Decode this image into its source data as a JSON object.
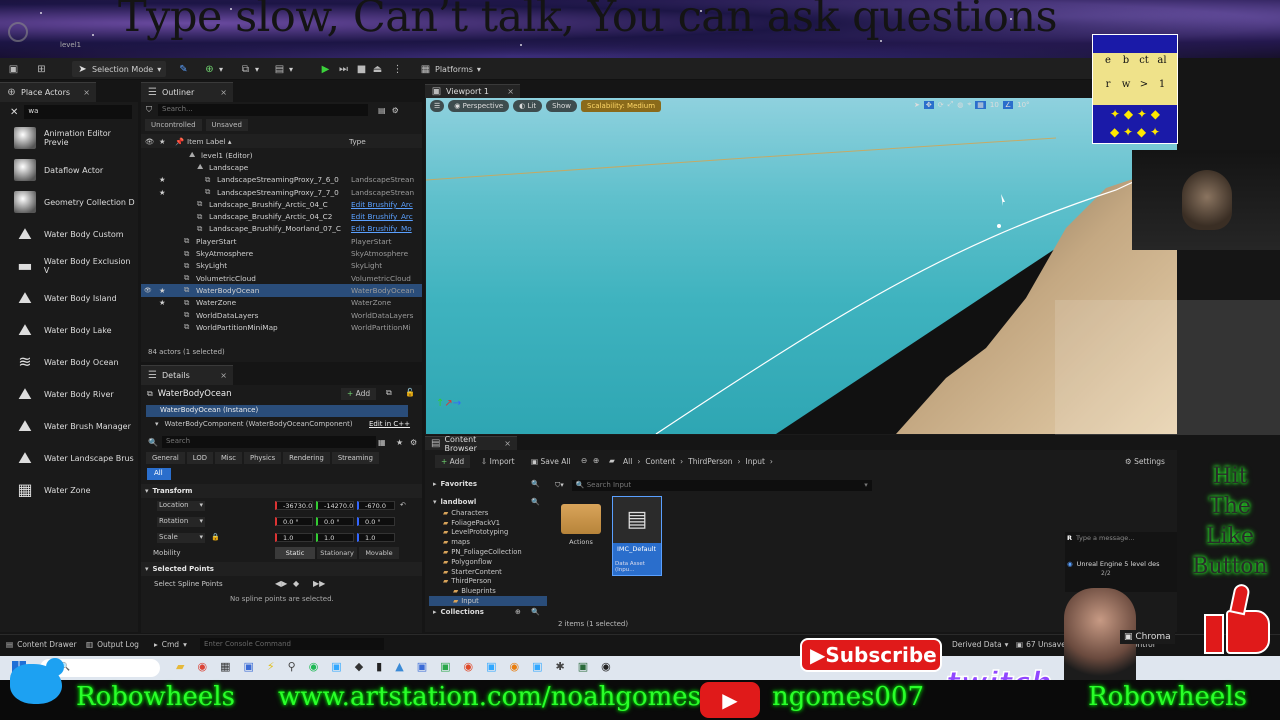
{
  "banner": {
    "title": "Type slow, Can’t talk, You can ask questions",
    "level": "level1"
  },
  "toolbar": {
    "selection_mode": "Selection Mode",
    "platforms": "Platforms"
  },
  "place_actors": {
    "tab": "Place Actors",
    "search_value": "wa",
    "items": [
      "Animation Editor Previe",
      "Dataflow Actor",
      "Geometry Collection D",
      "Water Body Custom",
      "Water Body Exclusion V",
      "Water Body Island",
      "Water Body Lake",
      "Water Body Ocean",
      "Water Body River",
      "Water Brush Manager",
      "Water Landscape Brus",
      "Water Zone"
    ]
  },
  "outliner": {
    "tab": "Outliner",
    "search_placeholder": "Search...",
    "filters": [
      "Uncontrolled",
      "Unsaved"
    ],
    "col_label": "Item Label ▴",
    "col_type": "Type",
    "rows": [
      {
        "label": "level1 (Editor)",
        "type": ""
      },
      {
        "label": "Landscape",
        "type": ""
      },
      {
        "label": "LandscapeStreamingProxy_7_6_0",
        "type": "LandscapeStrean"
      },
      {
        "label": "LandscapeStreamingProxy_7_7_0",
        "type": "LandscapeStrean"
      },
      {
        "label": "Landscape_Brushify_Arctic_04_C",
        "type": "Edit Brushify_Arc"
      },
      {
        "label": "Landscape_Brushify_Arctic_04_C2",
        "type": "Edit Brushify_Arc"
      },
      {
        "label": "Landscape_Brushify_Moorland_07_C",
        "type": "Edit Brushify_Mo"
      },
      {
        "label": "PlayerStart",
        "type": "PlayerStart"
      },
      {
        "label": "SkyAtmosphere",
        "type": "SkyAtmosphere"
      },
      {
        "label": "SkyLight",
        "type": "SkyLight"
      },
      {
        "label": "VolumetricCloud",
        "type": "VolumetricCloud"
      },
      {
        "label": "WaterBodyOcean",
        "type": "WaterBodyOcean"
      },
      {
        "label": "WaterZone",
        "type": "WaterZone"
      },
      {
        "label": "WorldDataLayers",
        "type": "WorldDataLayers"
      },
      {
        "label": "WorldPartitionMiniMap",
        "type": "WorldPartitionMi"
      }
    ],
    "status": "84 actors (1 selected)"
  },
  "details": {
    "tab": "Details",
    "object": "WaterBodyOcean",
    "add_label": "Add",
    "instance": "WaterBodyOcean (Instance)",
    "component": "WaterBodyComponent (WaterBodyOceanComponent)",
    "edit_cpp": "Edit in C++",
    "search_placeholder": "Search",
    "cat_tabs": [
      "General",
      "LOD",
      "Misc",
      "Physics",
      "Rendering",
      "Streaming"
    ],
    "all_label": "All",
    "transform_header": "Transform",
    "location_label": "Location",
    "location": [
      "-36730.0",
      "-14270.0",
      "-670.0"
    ],
    "rotation_label": "Rotation",
    "rotation": [
      "0.0 °",
      "0.0 °",
      "0.0 °"
    ],
    "scale_label": "Scale",
    "scale": [
      "1.0",
      "1.0",
      "1.0"
    ],
    "mobility_label": "Mobility",
    "mobility_options": [
      "Static",
      "Stationary",
      "Movable"
    ],
    "selected_points_header": "Selected Points",
    "select_spline_label": "Select Spline Points",
    "no_spline": "No spline points are selected."
  },
  "viewport": {
    "tab": "Viewport 1",
    "perspective": "Perspective",
    "lit": "Lit",
    "show": "Show",
    "scalability": "Scalability: Medium",
    "grid_value": "10",
    "angle_value": "10°"
  },
  "content_browser": {
    "tab": "Content Browser",
    "add": "Add",
    "import": "Import",
    "save_all": "Save All",
    "breadcrumbs": [
      "All",
      "Content",
      "ThirdPerson",
      "Input"
    ],
    "settings": "Settings",
    "favorites": "Favorites",
    "project": "landbowl",
    "search_placeholder": "Search Input",
    "folders": [
      "Characters",
      "FoliagePackV1",
      "LevelPrototyping",
      "maps",
      "PN_FoliageCollection",
      "Polygonflow",
      "StarterContent",
      "ThirdPerson",
      "Blueprints",
      "Input"
    ],
    "collections": "Collections",
    "assets": [
      {
        "name": "Actions",
        "kind": ""
      },
      {
        "name": "IMC_Default",
        "kind": "Data Asset (Inpu..."
      }
    ],
    "status": "2 items (1 selected)"
  },
  "statusbar": {
    "content_drawer": "Content Drawer",
    "output_log": "Output Log",
    "cmd": "Cmd",
    "console_placeholder": "Enter Console Command",
    "derived_data": "Derived Data",
    "unsaved": "67 Unsaved",
    "revision": "Revision Control"
  },
  "chat": {
    "placeholder": "Type a message...",
    "notification": "Unreal Engine 5 level des",
    "count": "2/2"
  },
  "overlay": {
    "hit_like": [
      "Hit",
      "The",
      "Like",
      "Button"
    ],
    "subscribe": "Subscribe",
    "twitch": "twitch",
    "chroma": "Chroma",
    "grid_letters": [
      "e",
      "b",
      "ct",
      "al",
      "r",
      "w",
      ">",
      "1"
    ]
  },
  "footer": {
    "left": "Robowheels",
    "url": "www.artstation.com/noahgomes",
    "youtube": "ngomes007",
    "right": "Robowheels"
  },
  "colors": {
    "accent_blue": "#2a6ecc",
    "selection": "#2a4d7a",
    "neon_green": "#2aff2a",
    "water": "#3fb3bf",
    "subscribe_red": "#e01a1a",
    "twitch_purple": "#9146ff"
  }
}
